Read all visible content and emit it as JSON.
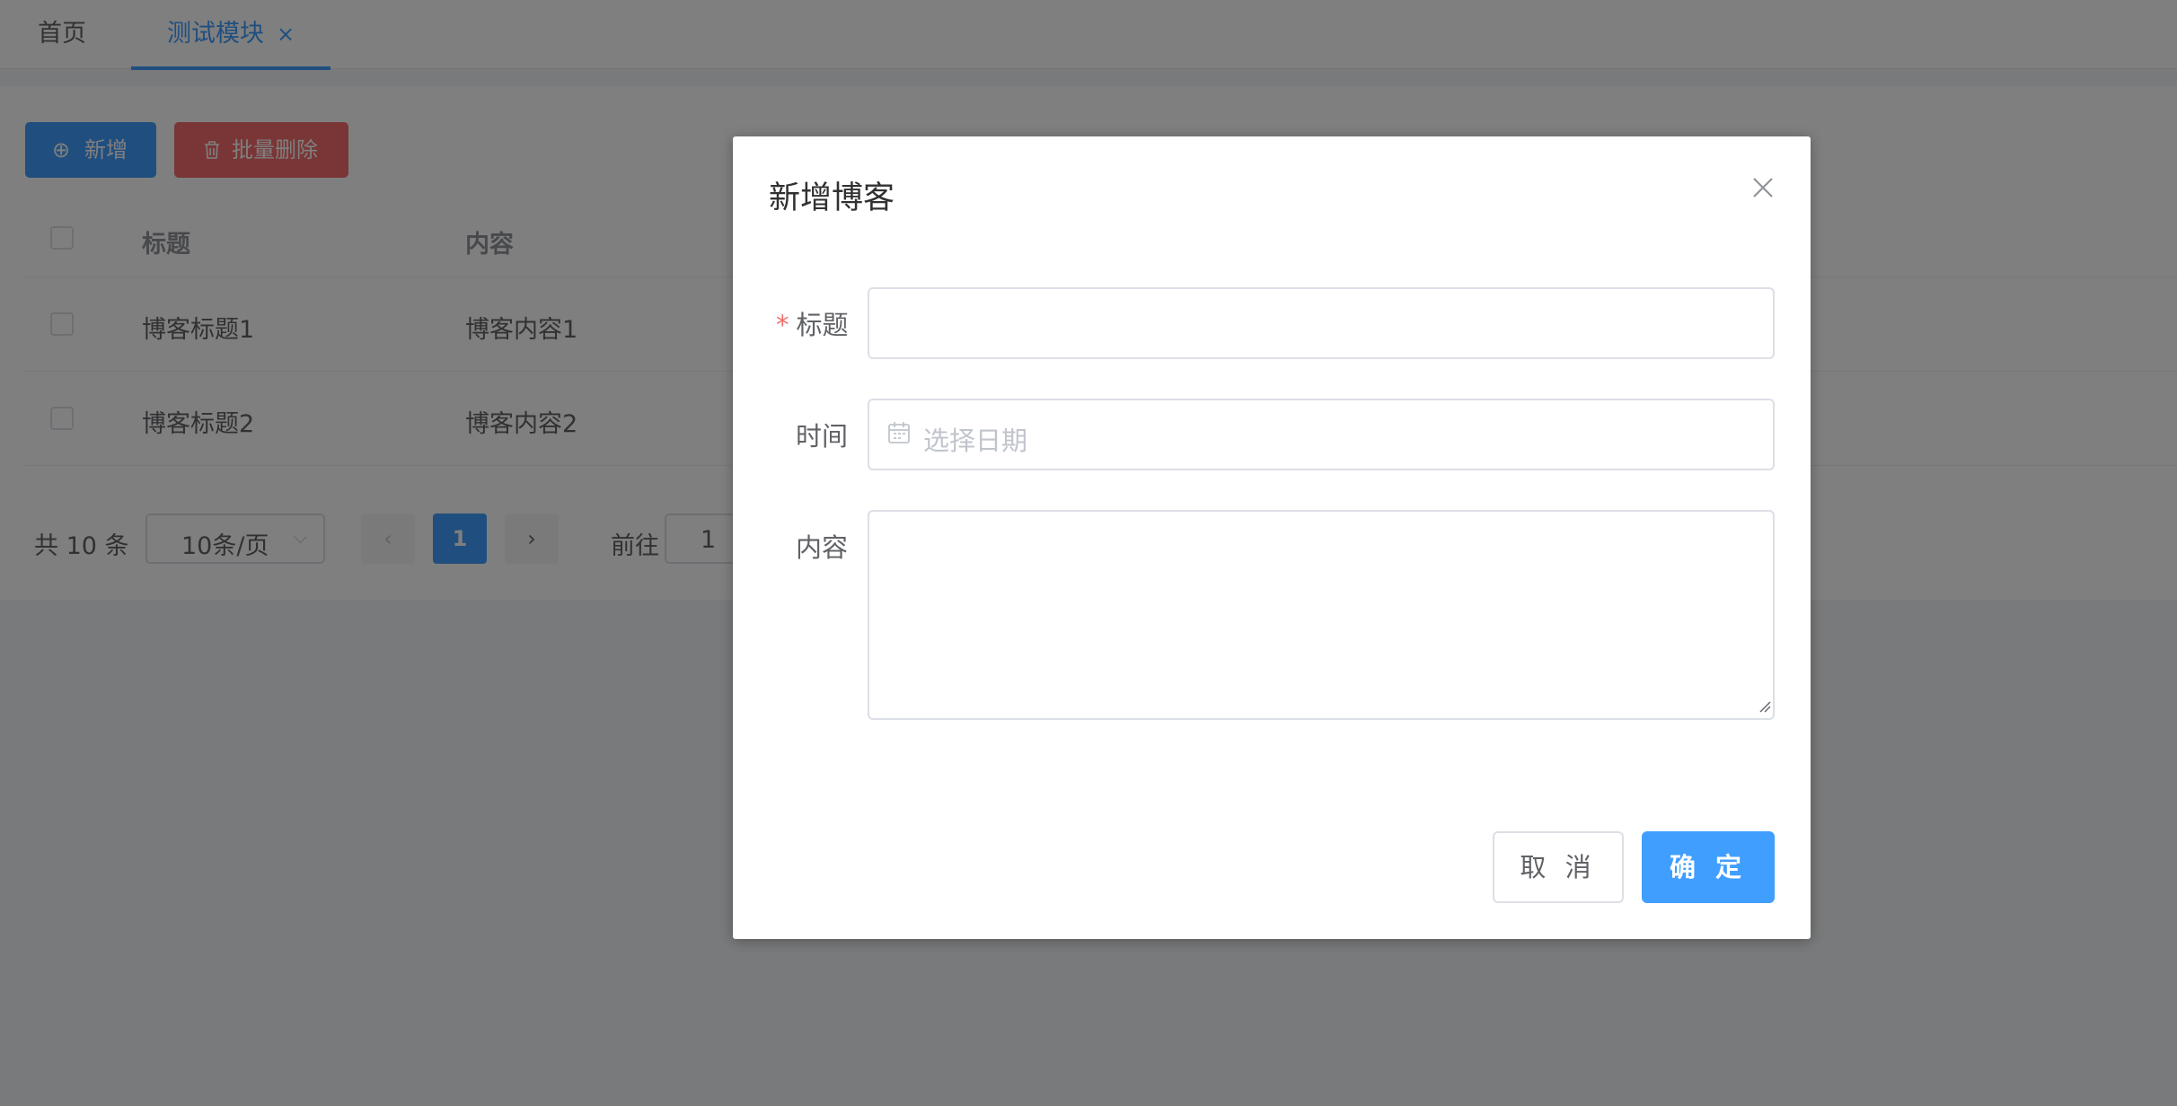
{
  "tabs": {
    "home_label": "首页",
    "active_label": "测试模块",
    "close_glyph": "×"
  },
  "toolbar": {
    "add_label": "新增",
    "batch_delete_label": "批量删除"
  },
  "table": {
    "headers": [
      "标题",
      "内容"
    ],
    "rows": [
      {
        "title": "博客标题1",
        "content": "博客内容1"
      },
      {
        "title": "博客标题2",
        "content": "博客内容2"
      }
    ]
  },
  "pagination": {
    "total_text": "共 10 条",
    "page_size": "10条/页",
    "current_page": "1",
    "goto_label": "前往",
    "goto_value": "1"
  },
  "dialog": {
    "title": "新增博客",
    "fields": {
      "title_label": "标题",
      "required_mark": "*",
      "time_label": "时间",
      "date_placeholder": "选择日期",
      "content_label": "内容"
    },
    "cancel_label": "取 消",
    "confirm_label": "确 定"
  },
  "colors": {
    "primary": "#409eff",
    "danger": "#f56c6c",
    "overlay": "rgba(0,0,0,0.5)"
  },
  "icons": [
    "plus-circle-icon",
    "trash-icon",
    "chevron-down-icon",
    "chevron-left-icon",
    "chevron-right-icon",
    "close-icon",
    "calendar-icon",
    "resize-handle-icon"
  ]
}
